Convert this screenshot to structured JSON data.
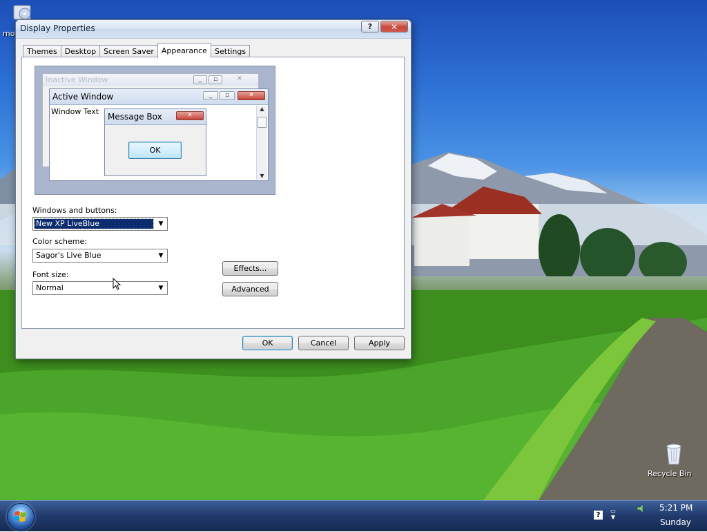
{
  "desktop": {
    "icons": [
      {
        "name": "cd-drive-icon",
        "label": "mo"
      },
      {
        "name": "recycle-bin-icon",
        "label": "Recycle Bin"
      }
    ]
  },
  "window": {
    "title": "Display Properties",
    "help_label": "?",
    "close_label": "✕",
    "tabs": [
      {
        "label": "Themes"
      },
      {
        "label": "Desktop"
      },
      {
        "label": "Screen Saver"
      },
      {
        "label": "Appearance",
        "active": true
      },
      {
        "label": "Settings"
      }
    ],
    "preview": {
      "inactive_title": "Inactive Window",
      "active_title": "Active Window",
      "window_text": "Window Text",
      "message_title": "Message Box",
      "ok_label": "OK"
    },
    "form": {
      "windows_buttons_label": "Windows and buttons:",
      "windows_buttons_value": "New XP LiveBlue",
      "color_scheme_label": "Color scheme:",
      "color_scheme_value": "Sagor's Live Blue",
      "font_size_label": "Font size:",
      "font_size_value": "Normal",
      "effects_label": "Effects...",
      "advanced_label": "Advanced"
    },
    "buttons": {
      "ok": "OK",
      "cancel": "Cancel",
      "apply": "Apply"
    }
  },
  "taskbar": {
    "clock_time": "5:21 PM",
    "clock_day": "Sunday",
    "help_icon_label": "?"
  },
  "colors": {
    "accent": "#0b2c6f",
    "close_button": "#c8463a",
    "taskbar": "#203a6a"
  }
}
